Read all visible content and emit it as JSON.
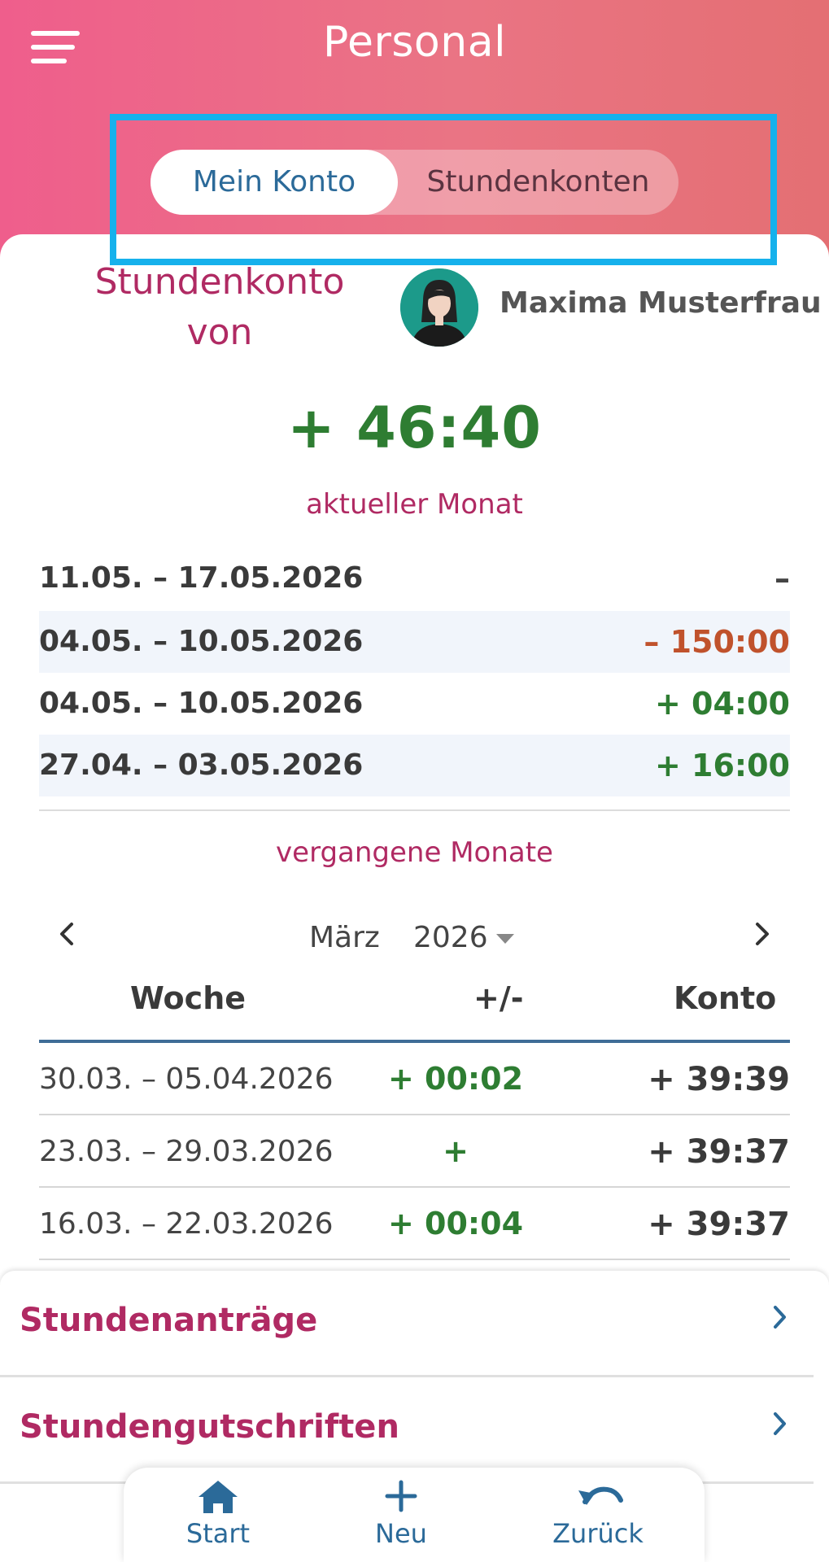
{
  "header": {
    "title": "Personal",
    "menu_icon": "hamburger-menu-icon"
  },
  "tabs": {
    "active": "Mein Konto",
    "inactive": "Stundenkonten"
  },
  "account": {
    "title_line1": "Stundenkonto",
    "title_line2": "von",
    "user_name": "Maxima Musterfrau",
    "balance": "+ 46:40"
  },
  "current_month": {
    "label": "aktueller Monat",
    "weeks": [
      {
        "range": "11.05. – 17.05.2026",
        "value": "–",
        "status": "none"
      },
      {
        "range": "04.05. – 10.05.2026",
        "value": "– 150:00",
        "status": "negative"
      },
      {
        "range": "04.05. – 10.05.2026",
        "value": "+ 04:00",
        "status": "positive"
      },
      {
        "range": "27.04. – 03.05.2026",
        "value": "+ 16:00",
        "status": "positive"
      }
    ]
  },
  "past_months": {
    "label": "vergangene Monate",
    "month": "März",
    "year": "2026",
    "prev_icon": "chevron-left-icon",
    "next_icon": "chevron-right-icon",
    "columns": [
      "Woche",
      "+/-",
      "Konto"
    ],
    "rows": [
      {
        "week": "30.03. – 05.04.2026",
        "delta": "+ 00:02",
        "konto": "+ 39:39"
      },
      {
        "week": "23.03. – 29.03.2026",
        "delta": "+",
        "konto": "+ 39:37"
      },
      {
        "week": "16.03. – 22.03.2026",
        "delta": "+ 00:04",
        "konto": "+ 39:37"
      }
    ]
  },
  "links": [
    {
      "label": "Stundenanträge",
      "icon": "chevron-right-icon"
    },
    {
      "label": "Stundengutschriften",
      "icon": "chevron-right-icon"
    }
  ],
  "bottom_nav": {
    "start": "Start",
    "neu": "Neu",
    "zurueck": "Zurück"
  },
  "colors": {
    "header_gradient_start": "#ef5e8c",
    "header_gradient_end": "#e46f73",
    "accent_magenta": "#b02a63",
    "accent_blue": "#2b6a99",
    "positive": "#2e7d32",
    "negative": "#c0522c",
    "highlight": "#16b1ec"
  }
}
